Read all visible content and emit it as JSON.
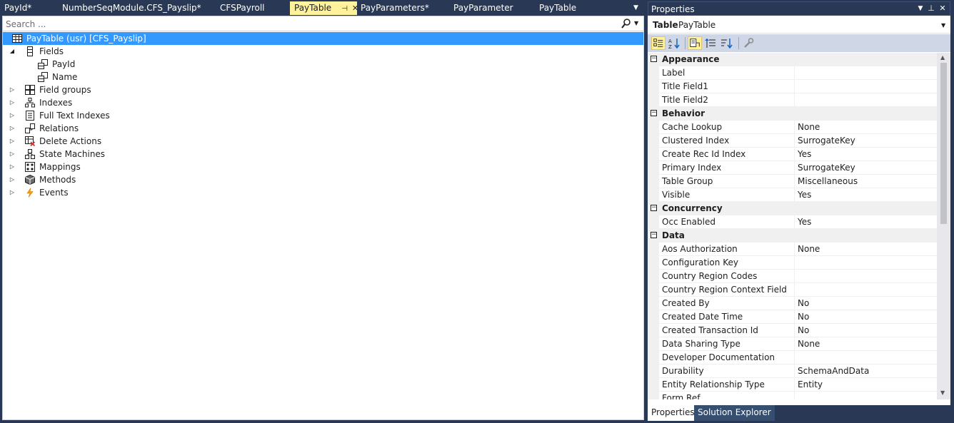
{
  "document_tabs": [
    {
      "label": "PayId*",
      "active": false
    },
    {
      "label": "NumberSeqModule.CFS_Payslip*",
      "active": false
    },
    {
      "label": "CFSPayroll",
      "active": false
    },
    {
      "label": "PayTable",
      "active": true
    },
    {
      "label": "PayParameters*",
      "active": false
    },
    {
      "label": "PayParameter",
      "active": false
    },
    {
      "label": "PayTable",
      "active": false
    }
  ],
  "search": {
    "placeholder": "Search ..."
  },
  "tree": {
    "root": "PayTable (usr) [CFS_Payslip]",
    "fields_label": "Fields",
    "fields": [
      "PayId",
      "Name"
    ],
    "nodes": [
      {
        "label": "Field groups",
        "icon": "field-groups-icon"
      },
      {
        "label": "Indexes",
        "icon": "indexes-icon"
      },
      {
        "label": "Full Text Indexes",
        "icon": "full-text-indexes-icon"
      },
      {
        "label": "Relations",
        "icon": "relations-icon"
      },
      {
        "label": "Delete Actions",
        "icon": "delete-actions-icon"
      },
      {
        "label": "State Machines",
        "icon": "state-machines-icon"
      },
      {
        "label": "Mappings",
        "icon": "mappings-icon"
      },
      {
        "label": "Methods",
        "icon": "methods-icon"
      },
      {
        "label": "Events",
        "icon": "events-icon"
      }
    ]
  },
  "properties": {
    "title": "Properties",
    "object_type": "Table",
    "object_name": "PayTable",
    "categories": [
      {
        "name": "Appearance",
        "rows": [
          {
            "name": "Label",
            "value": ""
          },
          {
            "name": "Title Field1",
            "value": ""
          },
          {
            "name": "Title Field2",
            "value": ""
          }
        ]
      },
      {
        "name": "Behavior",
        "rows": [
          {
            "name": "Cache Lookup",
            "value": "None"
          },
          {
            "name": "Clustered Index",
            "value": "SurrogateKey"
          },
          {
            "name": "Create Rec Id Index",
            "value": "Yes"
          },
          {
            "name": "Primary Index",
            "value": "SurrogateKey"
          },
          {
            "name": "Table Group",
            "value": "Miscellaneous"
          },
          {
            "name": "Visible",
            "value": "Yes"
          }
        ]
      },
      {
        "name": "Concurrency",
        "rows": [
          {
            "name": "Occ Enabled",
            "value": "Yes"
          }
        ]
      },
      {
        "name": "Data",
        "rows": [
          {
            "name": "Aos Authorization",
            "value": "None"
          },
          {
            "name": "Configuration Key",
            "value": ""
          },
          {
            "name": "Country Region Codes",
            "value": ""
          },
          {
            "name": "Country Region Context Field",
            "value": ""
          },
          {
            "name": "Created By",
            "value": "No"
          },
          {
            "name": "Created Date Time",
            "value": "No"
          },
          {
            "name": "Created Transaction Id",
            "value": "No"
          },
          {
            "name": "Data Sharing Type",
            "value": "None"
          },
          {
            "name": "Developer Documentation",
            "value": ""
          },
          {
            "name": "Durability",
            "value": "SchemaAndData"
          },
          {
            "name": "Entity Relationship Type",
            "value": "Entity"
          },
          {
            "name": "Form Ref",
            "value": ""
          }
        ]
      }
    ],
    "bottom_tabs": [
      {
        "label": "Properties",
        "active": true
      },
      {
        "label": "Solution Explorer",
        "active": false
      }
    ]
  },
  "colors": {
    "selection": "#3399ff",
    "chrome": "#293955",
    "active_tab": "#fff29d"
  }
}
